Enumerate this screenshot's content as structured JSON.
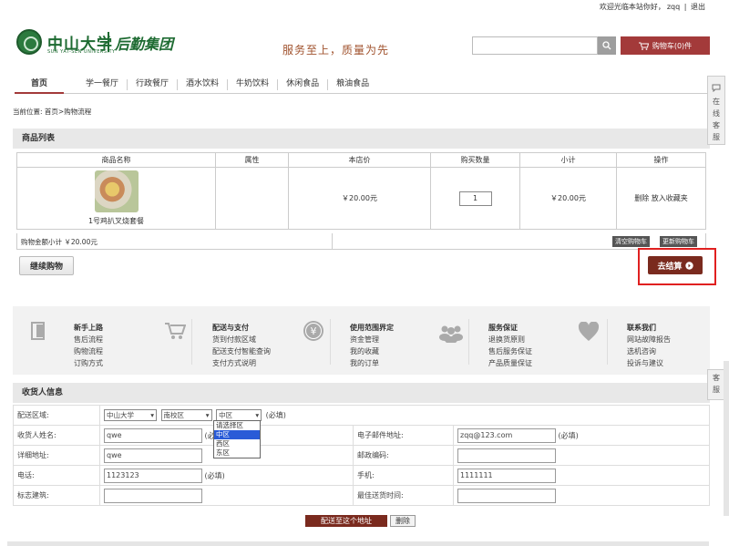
{
  "topbar": {
    "welcome": "欢迎光临本站你好，",
    "user": "zqq",
    "sep": "|",
    "logout": "退出"
  },
  "logo": {
    "cn": "中山大学",
    "en": "SUN YAT-SEN UNIVERSITY",
    "cn2": "后勤集团"
  },
  "slogan": "服务至上，质量为先",
  "search": {
    "placeholder": ""
  },
  "cart_button": "购物车(0)件",
  "nav": [
    "首页",
    "学一餐厅",
    "行政餐厅",
    "酒水饮料",
    "牛奶饮料",
    "休闲食品",
    "粮油食品"
  ],
  "breadcrumb": "当前位置: 首页>购物流程",
  "goods_section": "商品列表",
  "table_headers": [
    "商品名称",
    "属性",
    "本店价",
    "购买数量",
    "小计",
    "操作"
  ],
  "item": {
    "name": "1号鸡扒叉烧套餐",
    "price": "￥20.00元",
    "qty": "1",
    "subtotal": "￥20.00元",
    "actions": "删除 放入收藏夹"
  },
  "total": "购物金额小计 ￥20.00元",
  "clear_cart": "清空购物车",
  "update_cart": "更新购物车",
  "continue": "继续购物",
  "checkout": "去结算",
  "info": [
    {
      "title": "新手上路",
      "lines": [
        "售后流程",
        "购物流程",
        "订购方式"
      ]
    },
    {
      "title": "配送与支付",
      "lines": [
        "货到付款区域",
        "配送支付智能查询",
        "支付方式说明"
      ]
    },
    {
      "title": "使用范围界定",
      "lines": [
        "资金管理",
        "我的收藏",
        "我的订单"
      ]
    },
    {
      "title": "服务保证",
      "lines": [
        "退换货原则",
        "售后服务保证",
        "产品质量保证"
      ]
    },
    {
      "title": "联系我们",
      "lines": [
        "网站故障报告",
        "选机咨询",
        "投诉与建议"
      ]
    }
  ],
  "receiver_section": "收货人信息",
  "form": {
    "region_label": "配送区域:",
    "region": [
      "中山大学",
      "南校区",
      "中区"
    ],
    "required": "(必填)",
    "name_label": "收货人姓名:",
    "name": "qwe",
    "email_label": "电子邮件地址:",
    "email": "zqq@123.com",
    "address_label": "详细地址:",
    "address": "qwe",
    "zip_label": "邮政编码:",
    "phone_label": "电话:",
    "phone": "1123123",
    "mobile_label": "手机:",
    "mobile": "1111111",
    "landmark_label": "标志建筑:",
    "time_label": "最佳送货时间:"
  },
  "dropdown_options": [
    "请选择区",
    "中区",
    "西区",
    "东区"
  ],
  "deliver_button": "配送至这个地址",
  "delete_button": "删除",
  "float_tab": [
    "在",
    "线",
    "客",
    "服"
  ],
  "float_tab2": [
    "客",
    "服"
  ]
}
